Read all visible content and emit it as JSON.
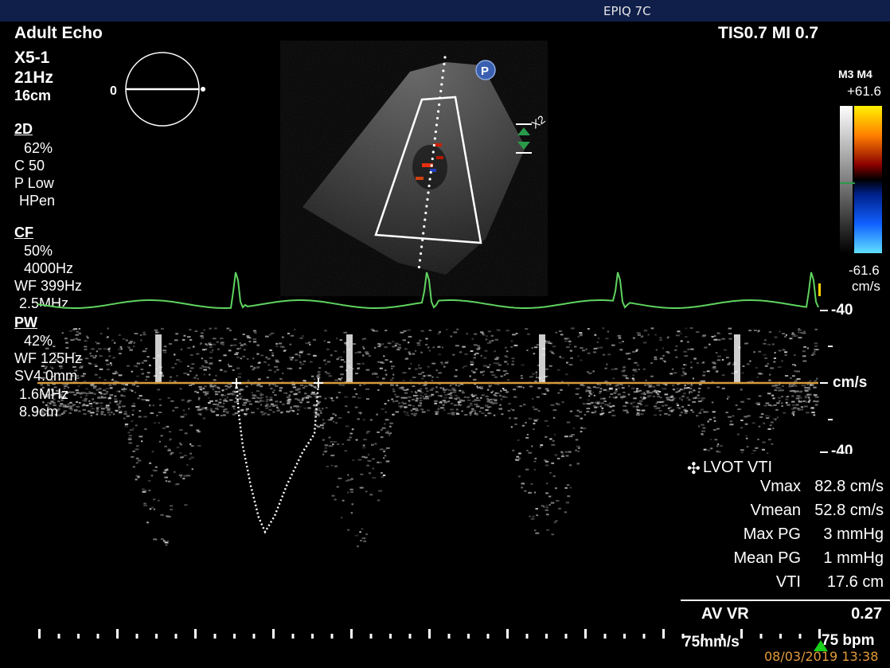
{
  "window": {
    "title": "EPIQ 7C"
  },
  "header": {
    "preset": "Adult Echo",
    "tis_mi": "TIS0.7   MI 0.7",
    "transducer": "X5-1",
    "frame_rate": "21Hz",
    "depth": "16cm",
    "angle_label": "0"
  },
  "mode_2d": {
    "title": "2D",
    "gain": "62%",
    "compression": "C 50",
    "persistence": "P Low",
    "harmonics": "HPen"
  },
  "mode_cf": {
    "title": "CF",
    "gain": "50%",
    "prf": "4000Hz",
    "wall_filter": "WF 399Hz",
    "frequency": "2.5MHz"
  },
  "mode_pw": {
    "title": "PW",
    "gain": "42%",
    "wall_filter": "WF 125Hz",
    "sample_volume": "SV4.0mm",
    "frequency": "1.6MHz",
    "gate_depth": "8.9cm"
  },
  "color_bar": {
    "maps": "M3 M4",
    "max": "+61.6",
    "min": "-61.6",
    "unit": "cm/s"
  },
  "image_icons": {
    "probe_orientation": "P",
    "zoom": "X2"
  },
  "doppler_scale": {
    "top": "-40",
    "baseline": "cm/s",
    "bottom": "-40"
  },
  "measurements": {
    "title": "LVOT VTI",
    "rows": [
      {
        "label": "Vmax",
        "value": "82.8 cm/s"
      },
      {
        "label": "Vmean",
        "value": "52.8 cm/s"
      },
      {
        "label": "Max PG",
        "value": "3 mmHg"
      },
      {
        "label": "Mean PG",
        "value": "1 mmHg"
      },
      {
        "label": "VTI",
        "value": "17.6 cm"
      }
    ],
    "av_vr_label": "AV VR",
    "av_vr_value": "0.27"
  },
  "footer": {
    "sweep_speed": "75mm/s",
    "heart_rate": "75 bpm",
    "datetime": "08/03/2019 13:38"
  },
  "colors": {
    "ecg": "#5fd35f",
    "baseline": "#d79a3a",
    "topbar": "#0f1f4a",
    "date": "#e39b3c"
  }
}
